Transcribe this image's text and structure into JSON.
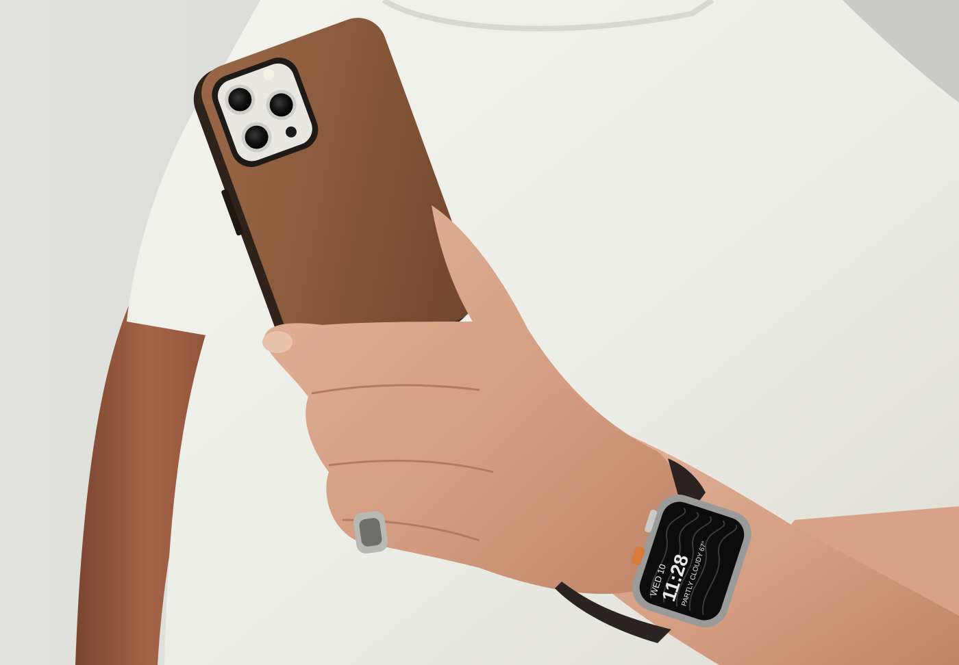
{
  "scene": {
    "subject": "person-holding-phone",
    "colors": {
      "background": "#d9dad7",
      "shirt": "#eeeee8",
      "skin": "#d7a287",
      "skin_shadow": "#a9674a",
      "case_leather": "#8a5a3c",
      "case_dark": "#3a2a20",
      "camera_plate": "#e9e7e2",
      "watch_case": "#9a9a98",
      "watch_band": "#2b2321",
      "watch_crown": "#d9793a",
      "ring": "#b8b8b4"
    }
  },
  "watch_face": {
    "day": "WED 10",
    "time": "11:28",
    "weather": "PARTLY CLOUDY 67°"
  }
}
